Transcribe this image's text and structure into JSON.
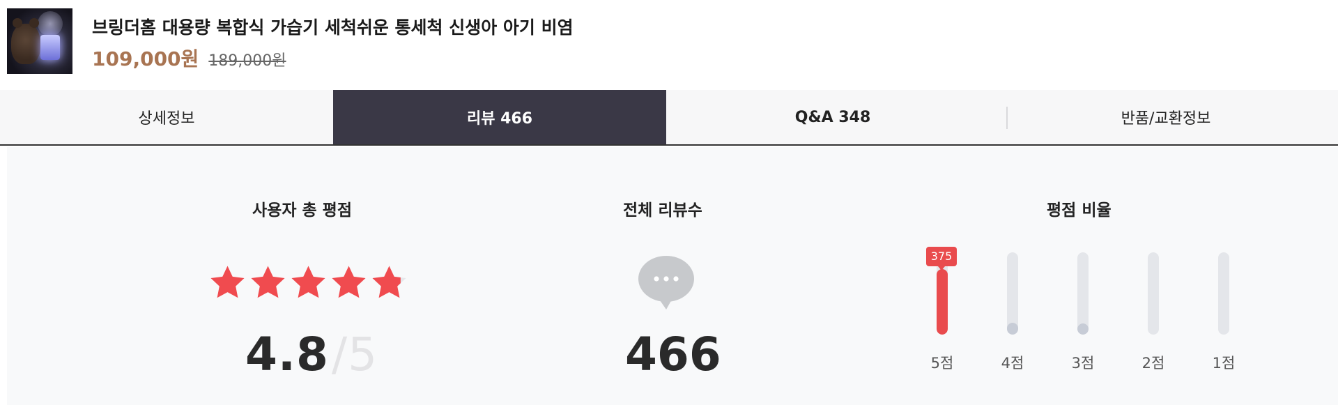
{
  "product": {
    "title": "브링더홈 대용량 복합식 가습기 세척쉬운 통세척 신생아 아기 비염",
    "sale_price": "109,000원",
    "original_price": "189,000원"
  },
  "tabs": [
    {
      "label": "상세정보",
      "active": false
    },
    {
      "label": "리뷰 466",
      "active": true
    },
    {
      "label": "Q&A 348",
      "active": false
    },
    {
      "label": "반품/교환정보",
      "active": false
    }
  ],
  "summary": {
    "rating_title": "사용자 총 평점",
    "rating_value": "4.8",
    "rating_slash": "/",
    "rating_max": "5",
    "rating_fraction": 0.96,
    "reviews_title": "전체 리뷰수",
    "reviews_count": "466",
    "distribution_title": "평점 비율",
    "distribution": [
      {
        "label": "5점",
        "count": "375",
        "fill": 0.8,
        "color": "#e94b4d"
      },
      {
        "label": "4점",
        "fill": 0.14,
        "color": "#c7ccd6"
      },
      {
        "label": "3점",
        "fill": 0.1,
        "color": "#c7ccd6"
      },
      {
        "label": "2점",
        "fill": 0.0,
        "color": "#c7ccd6"
      },
      {
        "label": "1점",
        "fill": 0.0,
        "color": "#c7ccd6"
      }
    ]
  },
  "colors": {
    "accent": "#a87452",
    "active_tab": "#3a3846",
    "star": "#f04b4f",
    "highlight_bar": "#e94b4d"
  }
}
